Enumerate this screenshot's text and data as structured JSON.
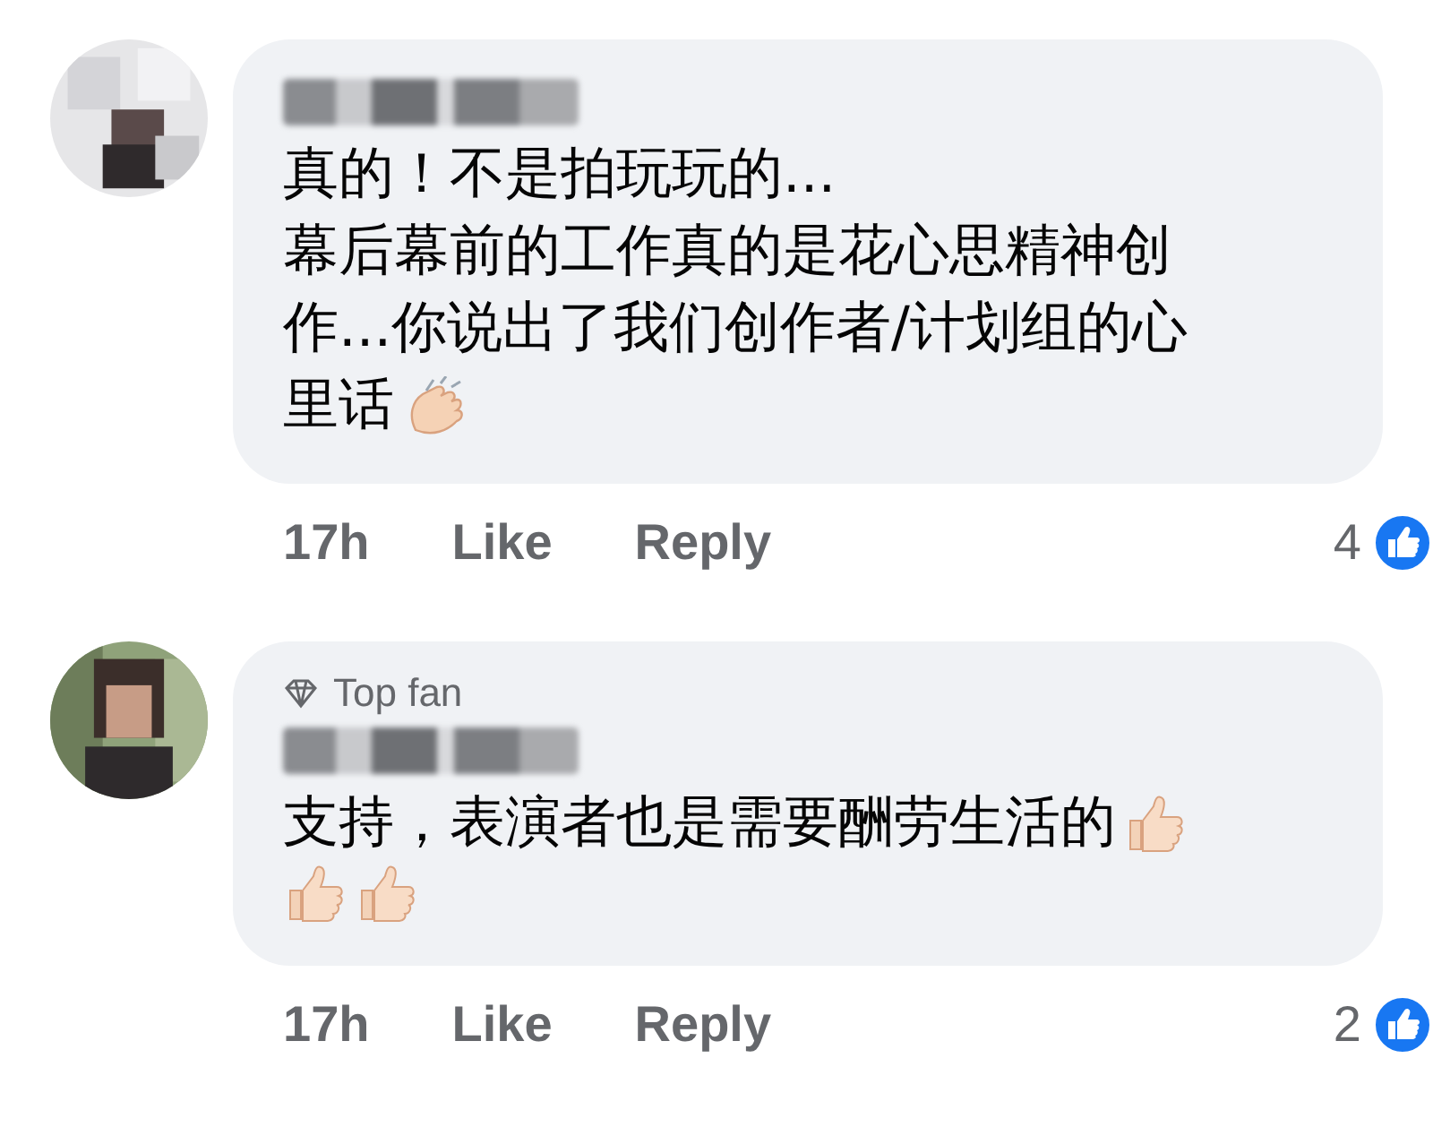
{
  "comments": [
    {
      "lines": [
        {
          "segments": [
            {
              "kind": "text",
              "text": "真的！不是拍玩玩的..."
            }
          ]
        },
        {
          "segments": [
            {
              "kind": "text",
              "text": "幕后幕前的工作真的是花心思精神创"
            }
          ]
        },
        {
          "segments": [
            {
              "kind": "text",
              "text": "作...你说出了我们创作者/计划组的心"
            }
          ]
        },
        {
          "segments": [
            {
              "kind": "text",
              "text": "里话"
            },
            {
              "kind": "clap"
            }
          ]
        }
      ],
      "time": "17h",
      "like": "Like",
      "reply": "Reply",
      "reactions": "4"
    },
    {
      "badge": "Top fan",
      "lines": [
        {
          "segments": [
            {
              "kind": "text",
              "text": "支持，表演者也是需要酬劳生活的"
            },
            {
              "kind": "thumbs"
            }
          ]
        },
        {
          "segments": [
            {
              "kind": "thumbs"
            },
            {
              "kind": "thumbs"
            }
          ]
        }
      ],
      "time": "17h",
      "like": "Like",
      "reply": "Reply",
      "reactions": "2"
    }
  ]
}
